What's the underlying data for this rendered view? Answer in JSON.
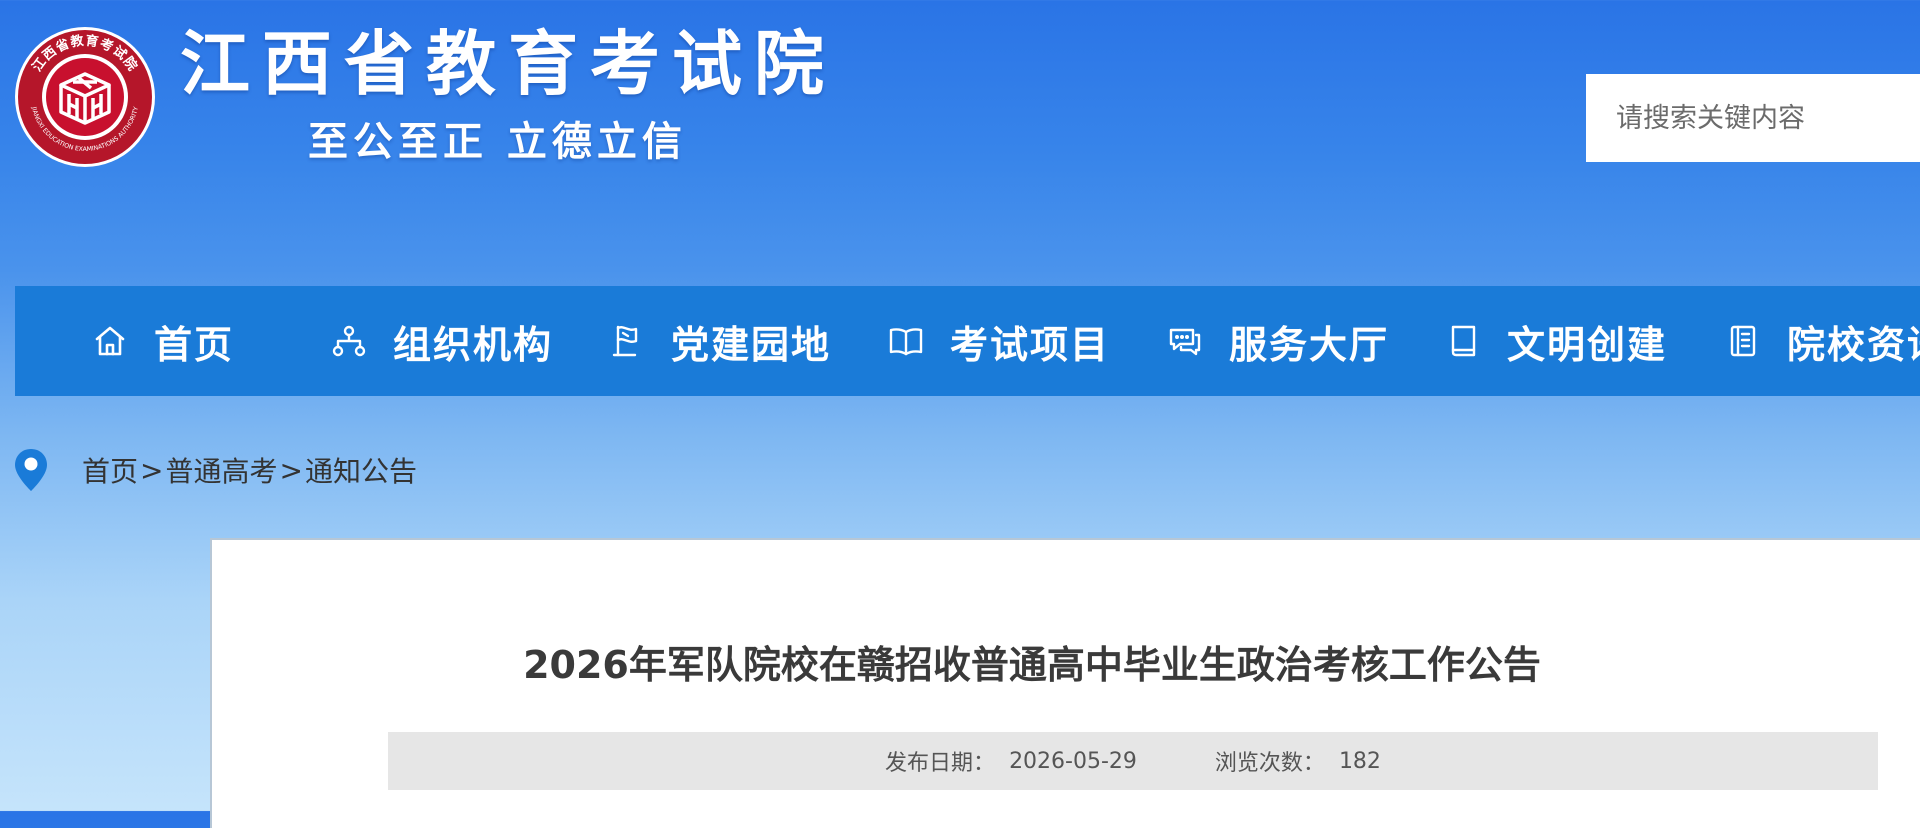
{
  "header": {
    "site_title": "江西省教育考试院",
    "motto": "至公至正 立德立信",
    "logo": {
      "ring_text_top": "江西省教育考试院",
      "ring_text_bottom": "JIANGXI EDUCATION EXAMINATIONS AUTHORITY",
      "colors": {
        "ring": "#b5162a",
        "inner": "#c8102e",
        "border": "#ffffff"
      }
    },
    "search": {
      "placeholder": "请搜索关键内容"
    }
  },
  "nav": {
    "items": [
      {
        "label": "首页",
        "icon": "home-icon"
      },
      {
        "label": "组织机构",
        "icon": "org-chart-icon"
      },
      {
        "label": "党建园地",
        "icon": "party-flag-icon"
      },
      {
        "label": "考试项目",
        "icon": "open-book-icon"
      },
      {
        "label": "服务大厅",
        "icon": "chat-service-icon"
      },
      {
        "label": "文明创建",
        "icon": "book-icon"
      },
      {
        "label": "院校资讯",
        "icon": "news-icon"
      }
    ],
    "colors": {
      "background": "#1a7bd8",
      "text": "#ffffff"
    }
  },
  "breadcrumb": {
    "items": [
      "首页",
      "普通高考",
      "通知公告"
    ],
    "separator": ">",
    "icon": "location-pin-icon",
    "icon_color": "#1a7bd8"
  },
  "article": {
    "title": "2026年军队院校在赣招收普通高中毕业生政治考核工作公告",
    "publish_label": "发布日期：",
    "publish_date": "2026-05-29",
    "views_label": "浏览次数：",
    "views": "182"
  }
}
